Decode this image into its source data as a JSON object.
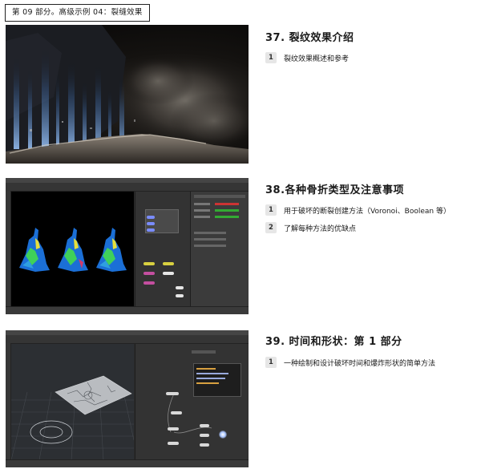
{
  "header": {
    "tag": "第 09 部分。高级示例 04：裂缝效果"
  },
  "sections": [
    {
      "title": "37. 裂纹效果介绍",
      "items": [
        {
          "num": "1",
          "text": "裂纹效果概述和参考"
        }
      ]
    },
    {
      "title": "38.各种骨折类型及注意事项",
      "items": [
        {
          "num": "1",
          "text": "用于破坏的断裂创建方法（Voronoi、Boolean 等）"
        },
        {
          "num": "2",
          "text": "了解每种方法的优缺点"
        }
      ]
    },
    {
      "title": "39. 时间和形状：第 1 部分",
      "items": [
        {
          "num": "1",
          "text": "一种绘制和设计破坏时间和爆炸形状的简单方法"
        }
      ]
    }
  ]
}
